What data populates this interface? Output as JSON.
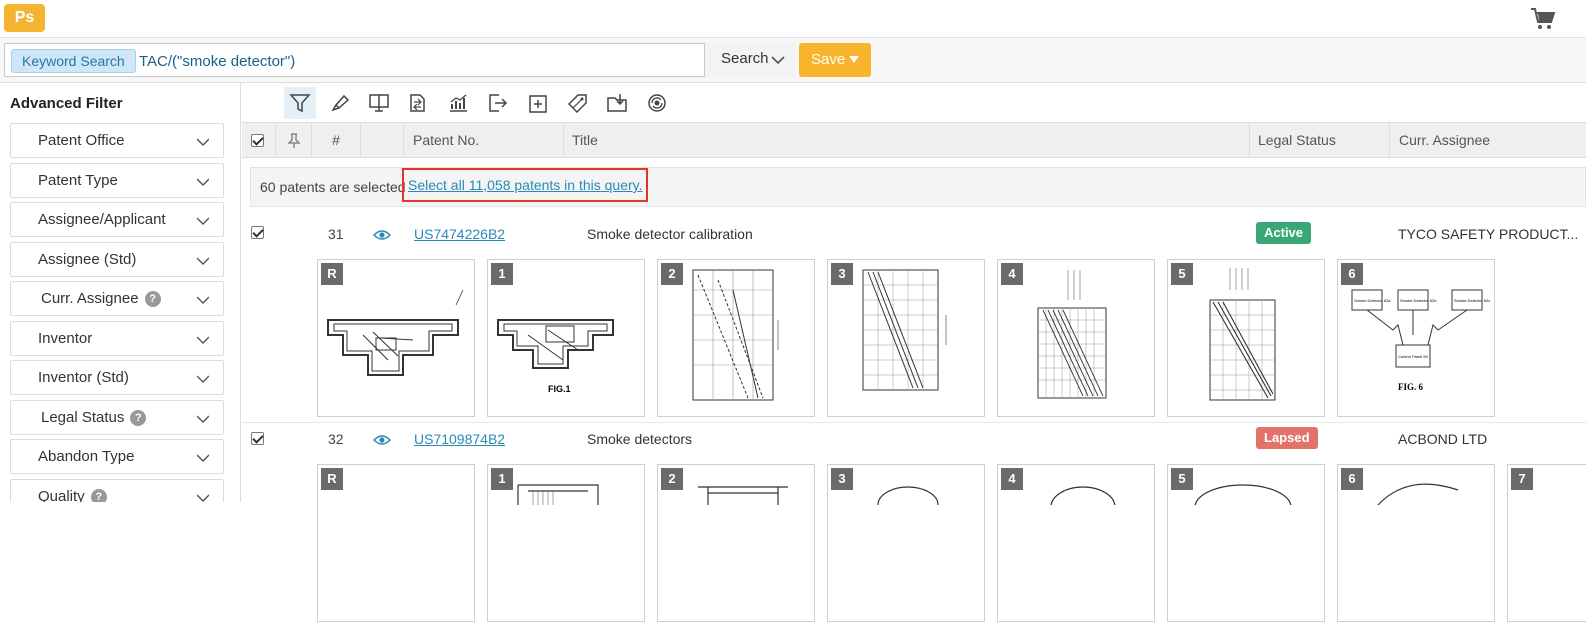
{
  "app": {
    "logo_text": "Ps"
  },
  "search": {
    "tag_label": "Keyword Search",
    "query": "TAC/(\"smoke detector\")",
    "search_label": "Search",
    "save_label": "Save"
  },
  "sidebar": {
    "title": "Advanced Filter",
    "filters": [
      {
        "label": "Patent Office"
      },
      {
        "label": "Patent Type"
      },
      {
        "label": "Assignee/Applicant"
      },
      {
        "label": "Assignee (Std)"
      },
      {
        "label": "Curr. Assignee"
      },
      {
        "label": "Inventor"
      },
      {
        "label": "Inventor (Std)"
      },
      {
        "label": "Legal Status"
      },
      {
        "label": "Abandon Type"
      },
      {
        "label": "Quality"
      }
    ],
    "help_glyph": "?"
  },
  "table": {
    "headers": {
      "index": "#",
      "patent_no": "Patent No.",
      "title": "Title",
      "legal_status": "Legal Status",
      "assignee": "Curr. Assignee"
    },
    "selection": {
      "text": "60 patents are selected",
      "link": "Select all 11,058 patents in this query."
    },
    "rows": [
      {
        "num": "31",
        "patent_no": "US7474226B2",
        "title": "Smoke detector calibration",
        "status": "Active",
        "status_color": "#3aa876",
        "assignee": "TYCO SAFETY PRODUCT...",
        "thumbs": [
          "R",
          "1",
          "2",
          "3",
          "4",
          "5",
          "6"
        ],
        "fig1_caption": "FIG.1",
        "fig6_caption": "FIG. 6",
        "fig6_box1": "Smoke Detector 62a",
        "fig6_box2": "Smoke Detector 62b",
        "fig6_box3": "Smoke Detector 62c",
        "fig6_panel": "Control Panel 60"
      },
      {
        "num": "32",
        "patent_no": "US7109874B2",
        "title": "Smoke detectors",
        "status": "Lapsed",
        "status_color": "#e2736b",
        "assignee": "ACBOND LTD",
        "thumbs": [
          "R",
          "1",
          "2",
          "3",
          "4",
          "5",
          "6",
          "7"
        ]
      }
    ]
  },
  "colors": {
    "accent": "#2a8ab7",
    "save": "#f7b42c",
    "highlight_border": "#e5352b"
  },
  "icons": [
    "shopping-cart-icon",
    "filter-icon",
    "highlighter-icon",
    "display-icon",
    "compare-icon",
    "analytics-icon",
    "export-icon",
    "add-icon",
    "tag-icon",
    "folder-save-icon",
    "translate-icon"
  ]
}
